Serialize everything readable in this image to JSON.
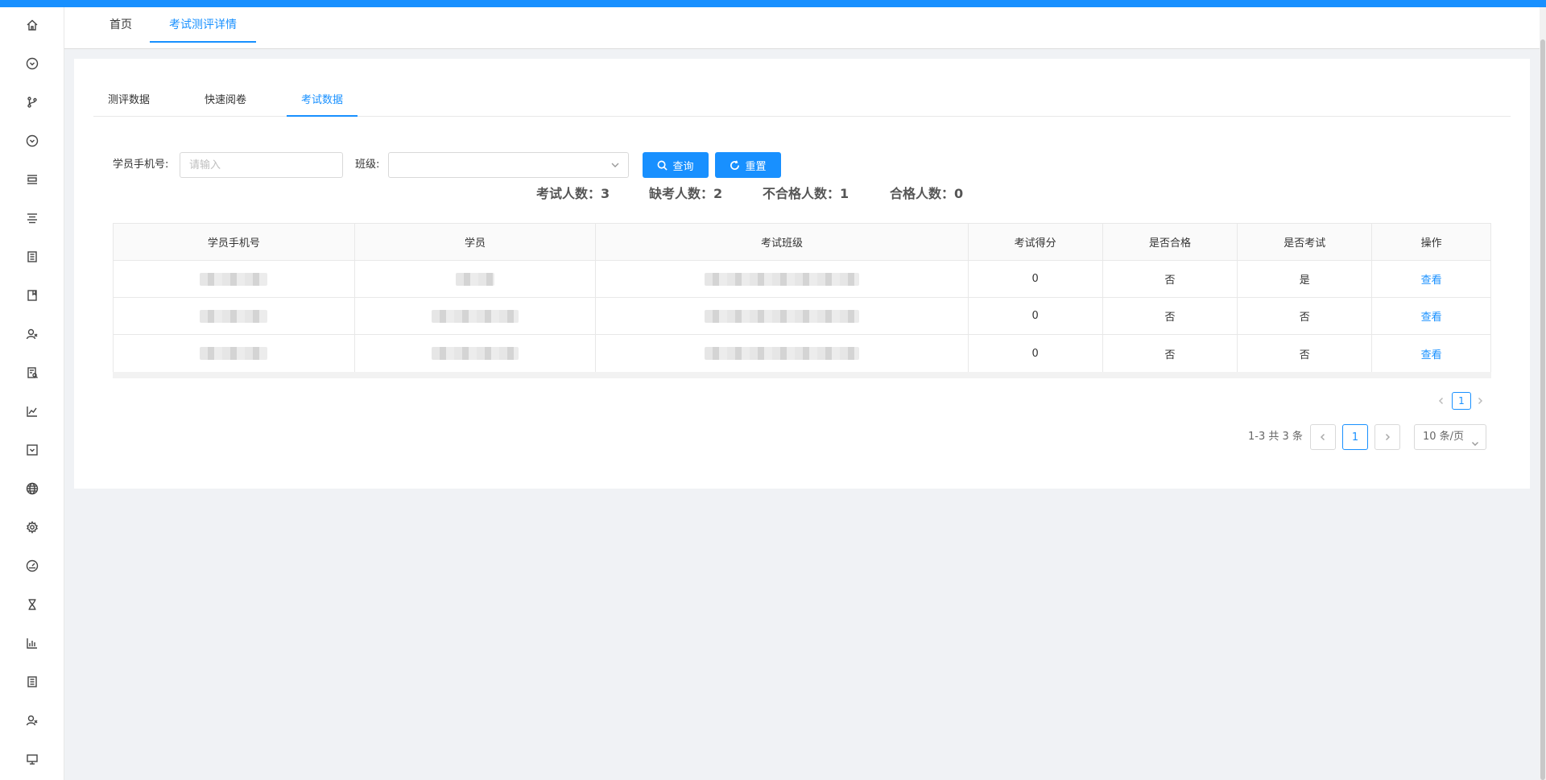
{
  "page_tabs": [
    {
      "label": "首页"
    },
    {
      "label": "考试测评详情"
    }
  ],
  "inner_tabs": [
    {
      "label": "测评数据"
    },
    {
      "label": "快速阅卷"
    },
    {
      "label": "考试数据"
    }
  ],
  "filters": {
    "phone_label": "学员手机号:",
    "phone_placeholder": "请输入",
    "phone_value": "",
    "class_label": "班级:",
    "class_value": "",
    "search_label": "查询",
    "reset_label": "重置"
  },
  "stats": [
    {
      "text": "考试人数：3"
    },
    {
      "text": "缺考人数：2"
    },
    {
      "text": "不合格人数：1"
    },
    {
      "text": "合格人数：0"
    }
  ],
  "table": {
    "headers": [
      "学员手机号",
      "学员",
      "考试班级",
      "考试得分",
      "是否合格",
      "是否考试",
      "操作"
    ],
    "rows": [
      {
        "score": "0",
        "passed": "否",
        "attended": "是",
        "action": "查看"
      },
      {
        "score": "0",
        "passed": "否",
        "attended": "否",
        "action": "查看"
      },
      {
        "score": "0",
        "passed": "否",
        "attended": "否",
        "action": "查看"
      }
    ]
  },
  "pagination": {
    "mini_current": "1",
    "total_text": "1-3 共 3 条",
    "current": "1",
    "page_size": "10 条/页"
  },
  "colors": {
    "primary": "#1890ff",
    "background": "#f0f2f5"
  },
  "sidebar_icons": [
    "home-icon",
    "circle-chevron-icon",
    "branch-icon",
    "circle-chevron-icon",
    "layout-icon",
    "align-center-icon",
    "book-icon",
    "bookmark-icon",
    "users-icon",
    "document-search-icon",
    "line-chart-icon",
    "square-chevron-icon",
    "globe-icon",
    "gear-icon",
    "dashboard-icon",
    "hourglass-icon",
    "bar-chart-icon",
    "book-icon",
    "users-icon",
    "monitor-icon"
  ]
}
